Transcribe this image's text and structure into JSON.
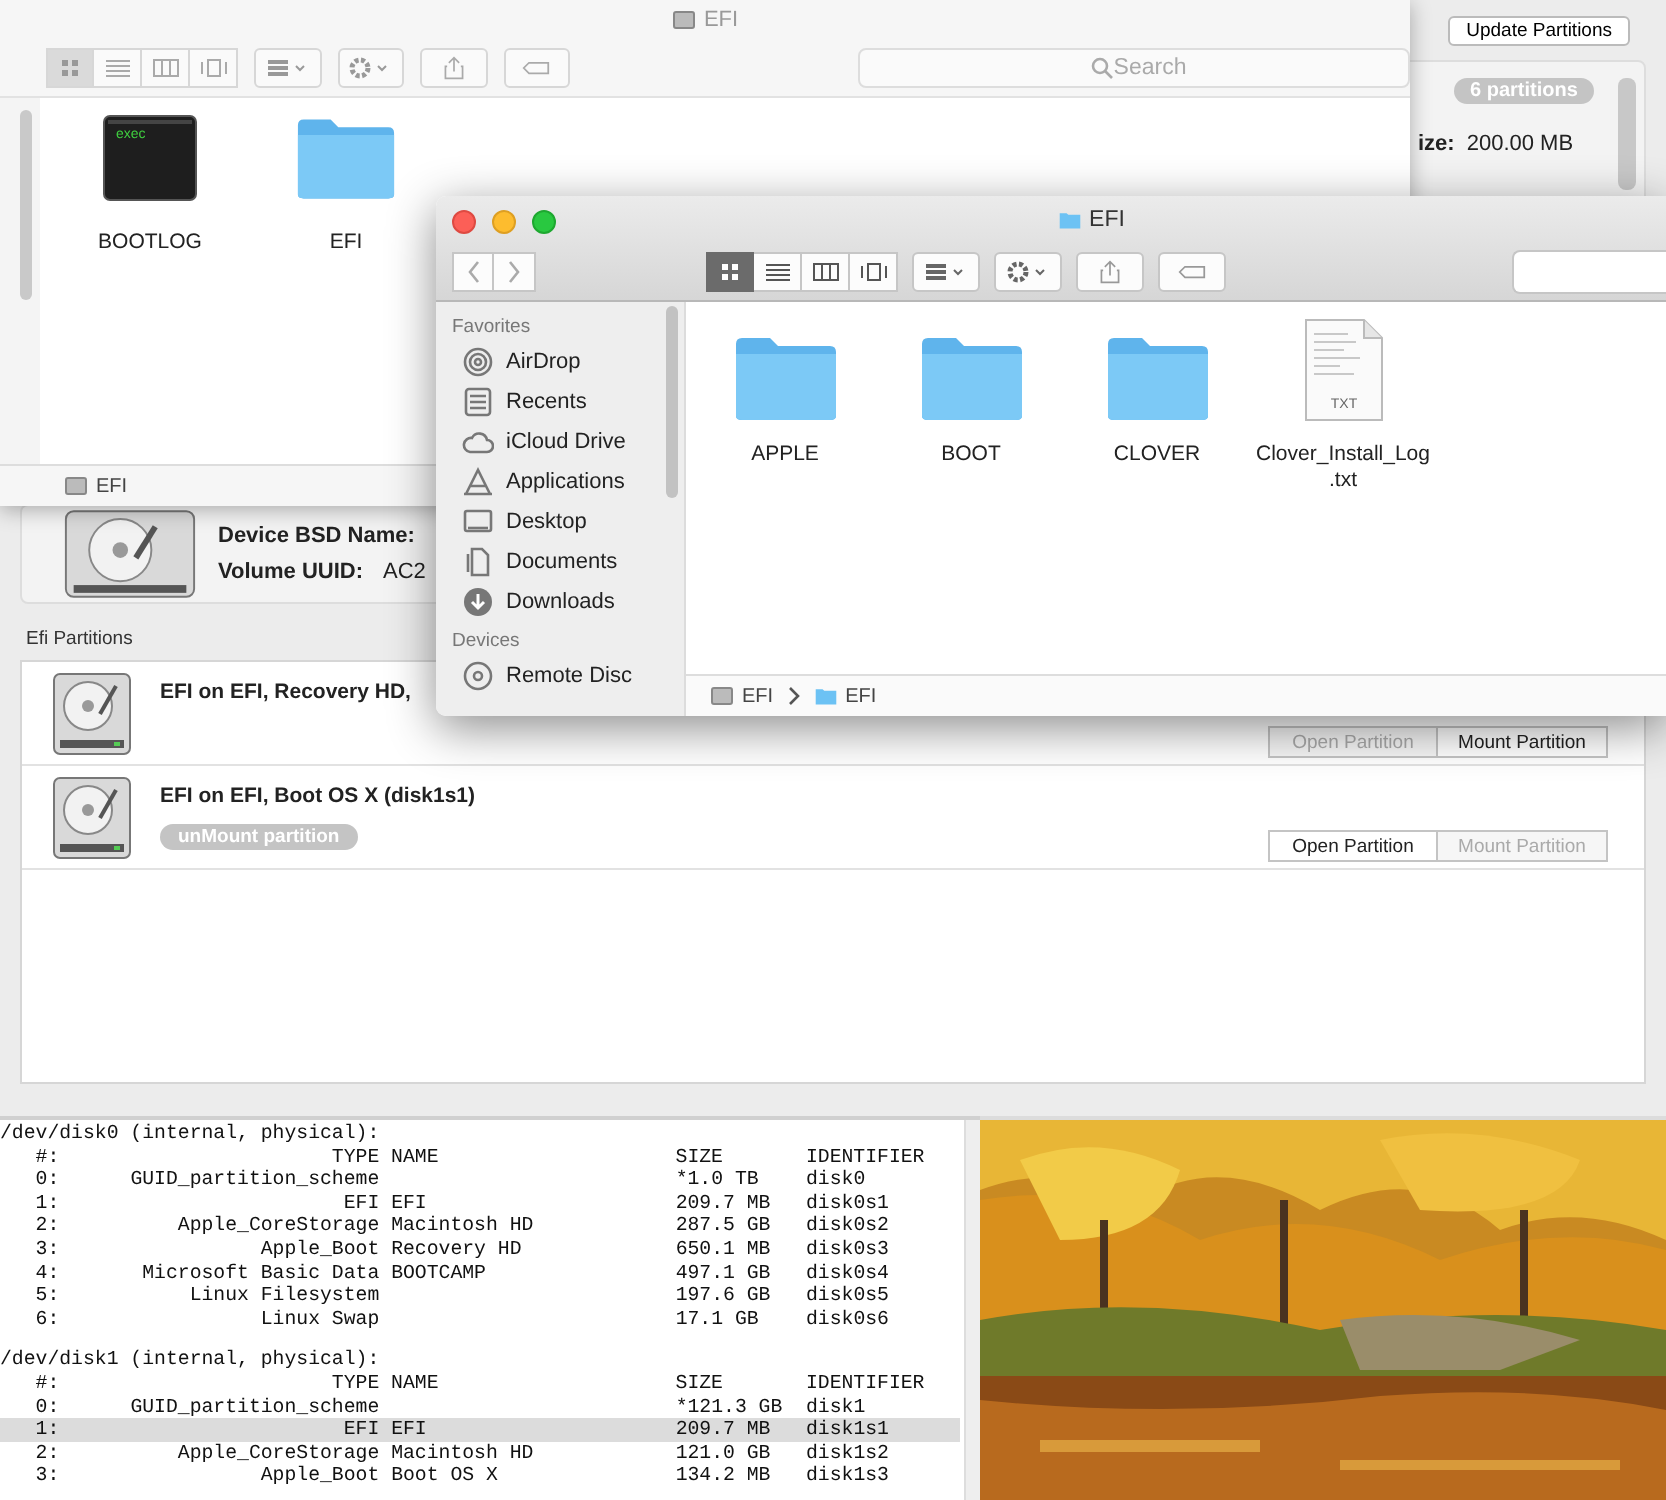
{
  "disk_utility": {
    "update_button": "Update Partitions",
    "partitions_badge": "6 partitions",
    "size_label": "ize:",
    "size_value": "200.00 MB",
    "device_bsd_label": "Device BSD Name:",
    "volume_uuid_label": "Volume UUID:",
    "volume_uuid_value": "AC2",
    "section_title": "Efi Partitions",
    "partitions": [
      {
        "title": "EFI on EFI, Recovery HD,",
        "open_button": {
          "label": "Open Partition",
          "disabled": true
        },
        "mount_button": {
          "label": "Mount Partition",
          "disabled": false
        }
      },
      {
        "title": "EFI on EFI, Boot OS X (disk1s1)",
        "badge": "unMount partition",
        "open_button": {
          "label": "Open Partition",
          "disabled": false
        },
        "mount_button": {
          "label": "Mount Partition",
          "disabled": true
        }
      }
    ]
  },
  "back_finder": {
    "title": "EFI",
    "search": {
      "placeholder": "Search"
    },
    "view_modes": [
      {
        "kind": "icon",
        "selected": true
      },
      {
        "kind": "list",
        "selected": false
      },
      {
        "kind": "column",
        "selected": false
      },
      {
        "kind": "cover",
        "selected": false
      }
    ],
    "items": [
      {
        "kind": "exec",
        "label": "BOOTLOG",
        "icon_text": "exec"
      },
      {
        "kind": "folder",
        "label": "EFI"
      }
    ],
    "path": [
      {
        "kind": "disk",
        "label": "EFI"
      }
    ]
  },
  "front_finder": {
    "title": "EFI",
    "view_modes": [
      {
        "kind": "icon",
        "selected": true
      },
      {
        "kind": "list",
        "selected": false
      },
      {
        "kind": "column",
        "selected": false
      },
      {
        "kind": "cover",
        "selected": false
      }
    ],
    "sidebar": [
      {
        "heading": "Favorites",
        "items": [
          {
            "kind": "airdrop",
            "label": "AirDrop"
          },
          {
            "kind": "recents",
            "label": "Recents"
          },
          {
            "kind": "icloud",
            "label": "iCloud Drive"
          },
          {
            "kind": "applications",
            "label": "Applications"
          },
          {
            "kind": "desktop",
            "label": "Desktop"
          },
          {
            "kind": "documents",
            "label": "Documents"
          },
          {
            "kind": "downloads",
            "label": "Downloads"
          }
        ]
      },
      {
        "heading": "Devices",
        "items": [
          {
            "kind": "disc",
            "label": "Remote Disc"
          }
        ]
      }
    ],
    "items": [
      {
        "kind": "folder",
        "label": "APPLE"
      },
      {
        "kind": "folder",
        "label": "BOOT"
      },
      {
        "kind": "folder",
        "label": "CLOVER"
      },
      {
        "kind": "text",
        "label": "Clover_Install_Log\n.txt",
        "icon_text": "TXT"
      }
    ],
    "path": [
      {
        "kind": "disk",
        "label": "EFI"
      },
      {
        "kind": "folder",
        "label": "EFI"
      }
    ]
  },
  "terminal": {
    "disks": [
      {
        "header": "/dev/disk0 (internal, physical):",
        "columns": [
          "#:",
          "TYPE",
          "NAME",
          "SIZE",
          "IDENTIFIER"
        ],
        "rows": [
          {
            "num": "0:",
            "type": "GUID_partition_scheme",
            "name": "",
            "size": "*1.0 TB",
            "identifier": "disk0",
            "selected": false
          },
          {
            "num": "1:",
            "type": "EFI",
            "name": "EFI",
            "size": "209.7 MB",
            "identifier": "disk0s1",
            "selected": false
          },
          {
            "num": "2:",
            "type": "Apple_CoreStorage",
            "name": "Macintosh HD",
            "size": "287.5 GB",
            "identifier": "disk0s2",
            "selected": false
          },
          {
            "num": "3:",
            "type": "Apple_Boot",
            "name": "Recovery HD",
            "size": "650.1 MB",
            "identifier": "disk0s3",
            "selected": false
          },
          {
            "num": "4:",
            "type": "Microsoft Basic Data",
            "name": "BOOTCAMP",
            "size": "497.1 GB",
            "identifier": "disk0s4",
            "selected": false
          },
          {
            "num": "5:",
            "type": "Linux Filesystem",
            "name": "",
            "size": "197.6 GB",
            "identifier": "disk0s5",
            "selected": false
          },
          {
            "num": "6:",
            "type": "Linux Swap",
            "name": "",
            "size": "17.1 GB",
            "identifier": "disk0s6",
            "selected": false
          }
        ]
      },
      {
        "header": "/dev/disk1 (internal, physical):",
        "columns": [
          "#:",
          "TYPE",
          "NAME",
          "SIZE",
          "IDENTIFIER"
        ],
        "rows": [
          {
            "num": "0:",
            "type": "GUID_partition_scheme",
            "name": "",
            "size": "*121.3 GB",
            "identifier": "disk1",
            "selected": false
          },
          {
            "num": "1:",
            "type": "EFI",
            "name": "EFI",
            "size": "209.7 MB",
            "identifier": "disk1s1",
            "selected": true
          },
          {
            "num": "2:",
            "type": "Apple_CoreStorage",
            "name": "Macintosh HD",
            "size": "121.0 GB",
            "identifier": "disk1s2",
            "selected": false
          },
          {
            "num": "3:",
            "type": "Apple_Boot",
            "name": "Boot OS X",
            "size": "134.2 MB",
            "identifier": "disk1s3",
            "selected": false
          }
        ]
      }
    ]
  }
}
